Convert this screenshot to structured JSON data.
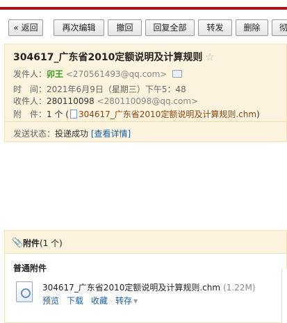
{
  "toolbar": {
    "buttons": [
      "« 返回",
      "再次编辑",
      "撤回",
      "回复全部",
      "转发",
      "删除",
      "彻"
    ]
  },
  "mail": {
    "subject": "304617_广东省2010定额说明及计算规则",
    "star": "☆",
    "sender_label": "发件人：",
    "sender_name": "卯王",
    "sender_email": "<270561493@qq.com>",
    "time_label": "时　间：",
    "time_value": "2021年6月9日（星期三）下午5：48",
    "recipient_label": "收件人：",
    "recipient_name": "280110098",
    "recipient_email": "<280110098@qq.com>",
    "attachment_label": "附　件：",
    "attachment_count": "1 个 (",
    "attachment_name": "304617_广东省2010定额说明及计算规则.chm",
    "attachment_close": ")",
    "status_label": "发送状态：",
    "status_value": "投递成功",
    "status_detail": "[查看详情]"
  },
  "attachments_panel": {
    "clip_icon": "paperclip-icon",
    "title_bold": "附件",
    "title_count": "(1 个)",
    "section_label": "普通附件",
    "file_icon": "chm-file-icon",
    "file_name": "304617_广东省2010定额说明及计算规则.chm",
    "file_size": "(1.22M)",
    "actions": [
      "预览",
      "下载",
      "收藏",
      "转存"
    ],
    "more_symbol": "▾"
  },
  "colors": {
    "header_bg": "#fbf3dd",
    "top_red": "#a8131b",
    "link_blue": "#1a5fa8",
    "sender_green": "#3b9a1c"
  }
}
